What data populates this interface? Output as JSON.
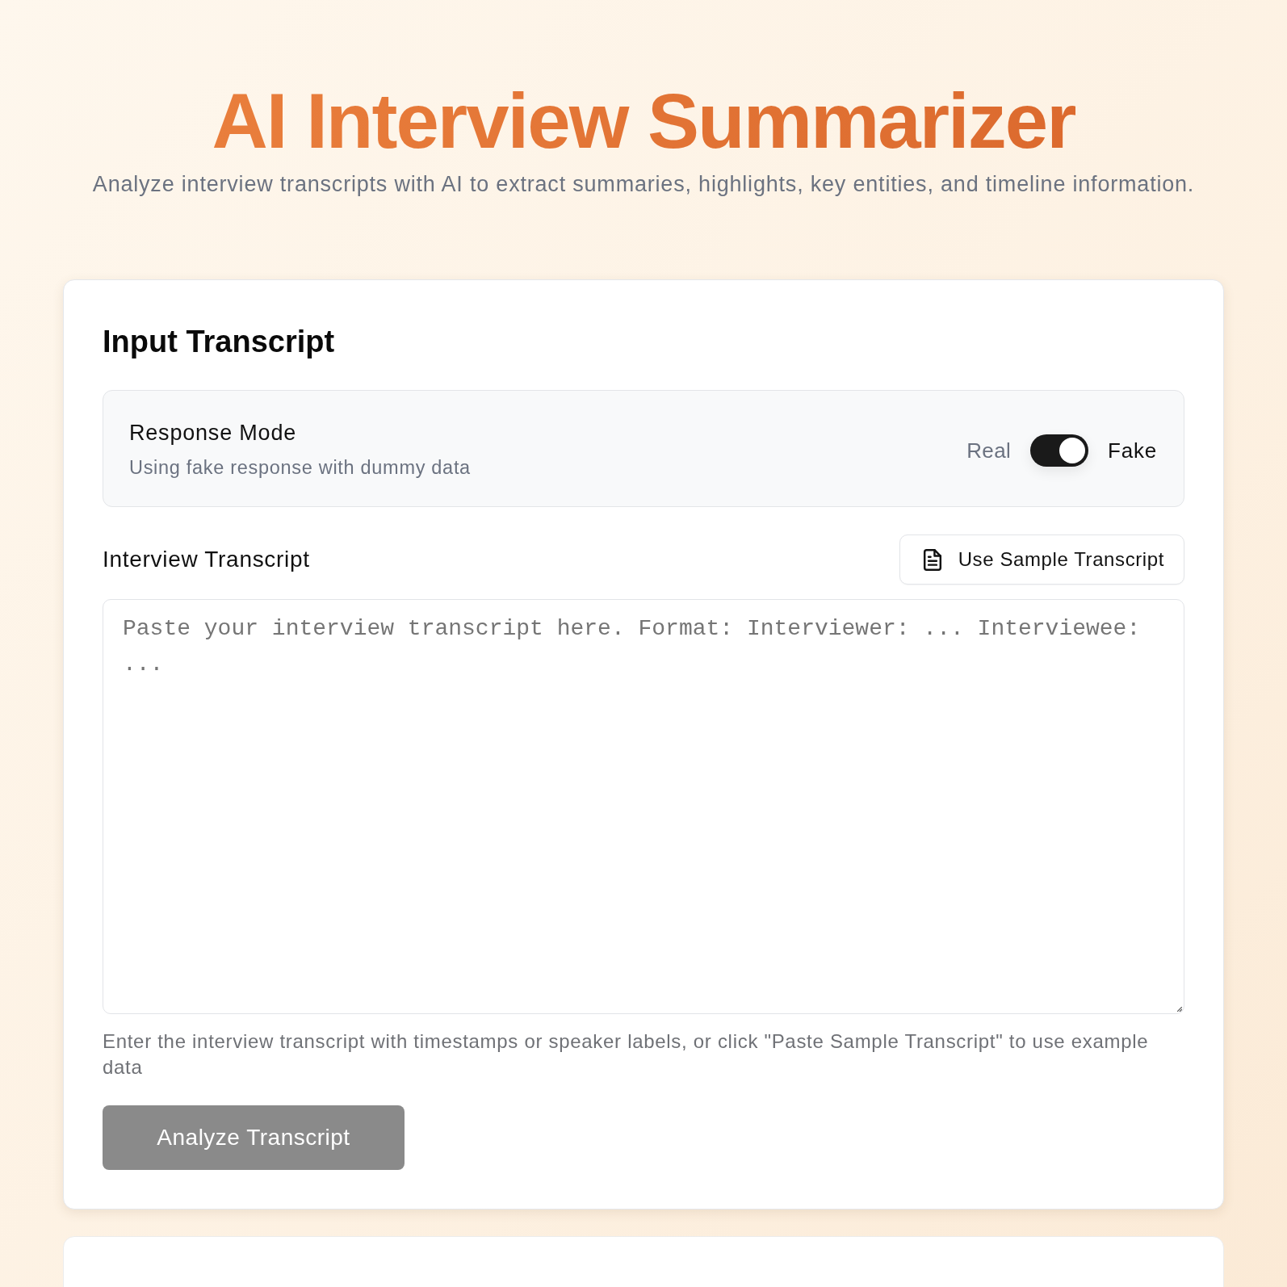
{
  "header": {
    "title": "AI Interview Summarizer",
    "subtitle": "Analyze interview transcripts with AI to extract summaries, highlights, key entities, and timeline information."
  },
  "input_card": {
    "title": "Input Transcript",
    "response_mode": {
      "title": "Response Mode",
      "description": "Using fake response with dummy data",
      "off_label": "Real",
      "on_label": "Fake",
      "on": true
    },
    "transcript": {
      "label": "Interview Transcript",
      "sample_button": "Use Sample Transcript",
      "placeholder": "Paste your interview transcript here. Format: Interviewer: ... Interviewee: ...",
      "help": "Enter the interview transcript with timestamps or speaker labels, or click \"Paste Sample Transcript\" to use example data"
    },
    "analyze_button": {
      "label": "Analyze Transcript",
      "disabled": true
    }
  }
}
